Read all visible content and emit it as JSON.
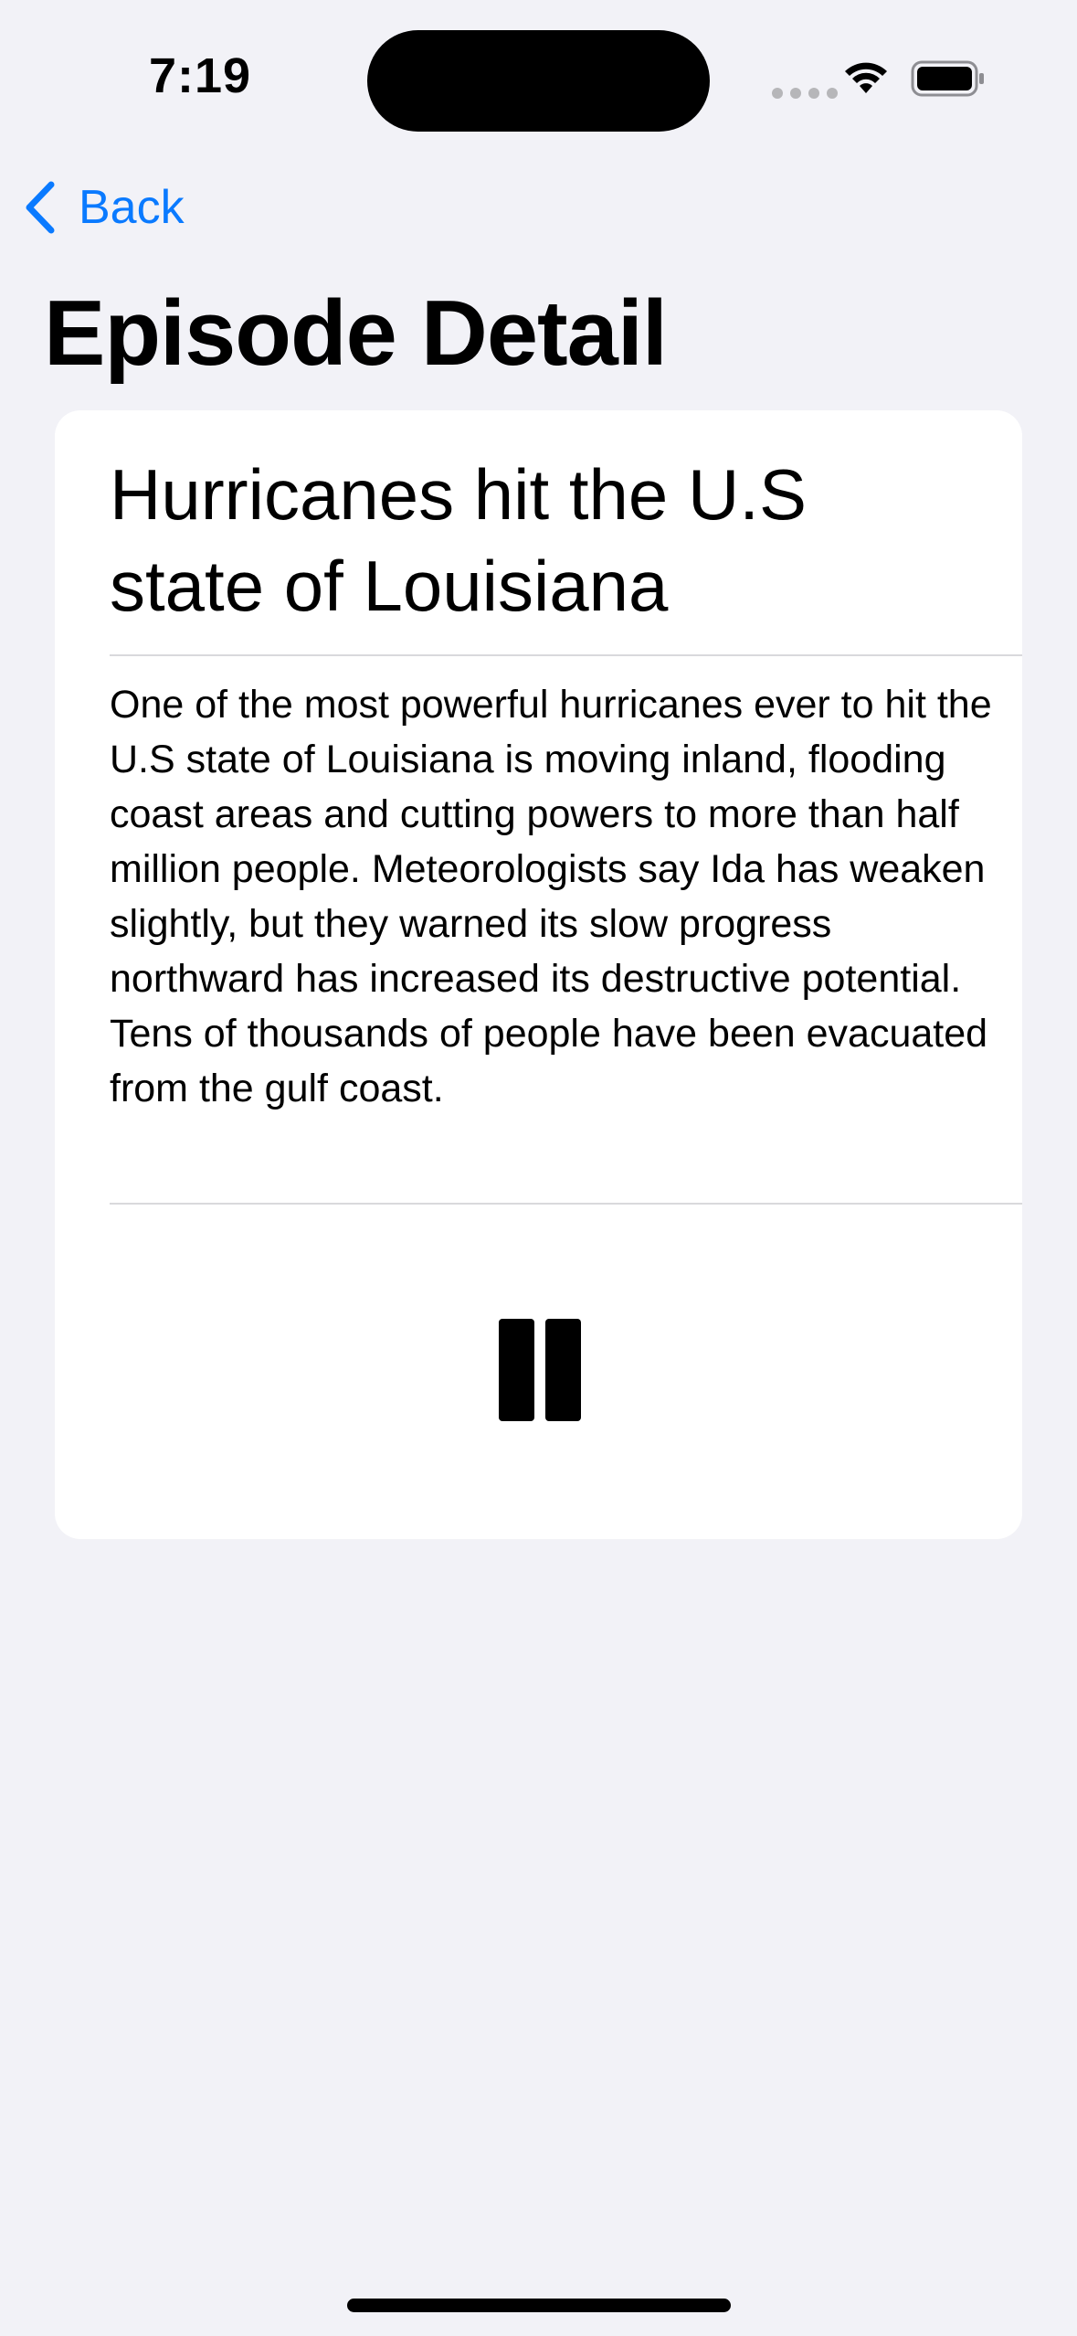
{
  "status_bar": {
    "time": "7:19",
    "icons": [
      "cellular-signal-icon",
      "wifi-icon",
      "battery-icon"
    ]
  },
  "nav": {
    "back_label": "Back",
    "back_icon": "chevron-left-icon",
    "title": "Episode Detail"
  },
  "episode": {
    "title": "Hurricanes hit the U.S state of Louisiana",
    "description": "One of the most powerful hurricanes ever to hit the U.S state of Louisiana is moving inland, flooding coast areas and cutting powers to more than half million people. Meteorologists say Ida has weaken slightly, but they warned its slow progress northward has increased its destructive potential. Tens of thousands of people have been evacuated from the gulf coast.",
    "playback_icon": "pause-icon"
  },
  "colors": {
    "background": "#f2f2f7",
    "accent": "#0a7aff",
    "card": "#ffffff"
  }
}
